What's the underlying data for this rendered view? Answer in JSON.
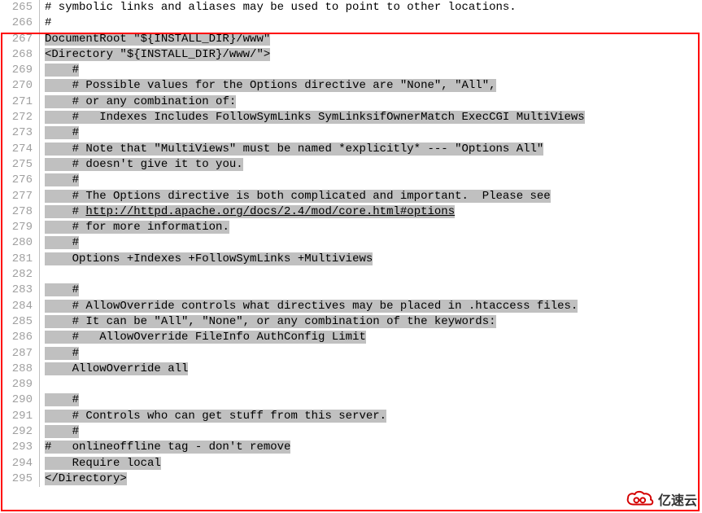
{
  "lines": [
    {
      "num": "265",
      "segs": [
        {
          "t": "# symbolic links and aliases may be used to point to other locations.",
          "hl": false
        }
      ]
    },
    {
      "num": "266",
      "segs": [
        {
          "t": "#",
          "hl": false
        }
      ]
    },
    {
      "num": "267",
      "segs": [
        {
          "t": "DocumentRoot \"${INSTALL_DIR}/www\"",
          "hl": true
        }
      ]
    },
    {
      "num": "268",
      "segs": [
        {
          "t": "<Directory \"${INSTALL_DIR}/www/\">",
          "hl": true
        }
      ]
    },
    {
      "num": "269",
      "segs": [
        {
          "t": "    ",
          "hl": true
        },
        {
          "t": "#",
          "hl": true
        }
      ]
    },
    {
      "num": "270",
      "segs": [
        {
          "t": "    ",
          "hl": true
        },
        {
          "t": "# Possible values for the Options directive are \"None\", \"All\",",
          "hl": true
        }
      ]
    },
    {
      "num": "271",
      "segs": [
        {
          "t": "    ",
          "hl": true
        },
        {
          "t": "# or any combination of:",
          "hl": true
        }
      ]
    },
    {
      "num": "272",
      "segs": [
        {
          "t": "    ",
          "hl": true
        },
        {
          "t": "#   Indexes Includes FollowSymLinks SymLinksifOwnerMatch ExecCGI MultiViews",
          "hl": true
        }
      ]
    },
    {
      "num": "273",
      "segs": [
        {
          "t": "    ",
          "hl": true
        },
        {
          "t": "#",
          "hl": true
        }
      ]
    },
    {
      "num": "274",
      "segs": [
        {
          "t": "    ",
          "hl": true
        },
        {
          "t": "# Note that \"MultiViews\" must be named *explicitly* --- \"Options All\"",
          "hl": true
        }
      ]
    },
    {
      "num": "275",
      "segs": [
        {
          "t": "    ",
          "hl": true
        },
        {
          "t": "# doesn't give it to you.",
          "hl": true
        }
      ]
    },
    {
      "num": "276",
      "segs": [
        {
          "t": "    ",
          "hl": true
        },
        {
          "t": "#",
          "hl": true
        }
      ]
    },
    {
      "num": "277",
      "segs": [
        {
          "t": "    ",
          "hl": true
        },
        {
          "t": "# The Options directive is both complicated and important.  Please see",
          "hl": true
        }
      ]
    },
    {
      "num": "278",
      "segs": [
        {
          "t": "    ",
          "hl": true
        },
        {
          "t": "# ",
          "hl": true
        },
        {
          "t": "http://httpd.apache.org/docs/2.4/mod/core.html#options",
          "hl": true,
          "u": true
        }
      ]
    },
    {
      "num": "279",
      "segs": [
        {
          "t": "    ",
          "hl": true
        },
        {
          "t": "# for more information.",
          "hl": true
        }
      ]
    },
    {
      "num": "280",
      "segs": [
        {
          "t": "    ",
          "hl": true
        },
        {
          "t": "#",
          "hl": true
        }
      ]
    },
    {
      "num": "281",
      "segs": [
        {
          "t": "    ",
          "hl": true
        },
        {
          "t": "Options +Indexes +FollowSymLinks +Multiviews",
          "hl": true
        }
      ]
    },
    {
      "num": "282",
      "segs": [
        {
          "t": "",
          "hl": false
        }
      ]
    },
    {
      "num": "283",
      "segs": [
        {
          "t": "    ",
          "hl": true
        },
        {
          "t": "#",
          "hl": true
        }
      ]
    },
    {
      "num": "284",
      "segs": [
        {
          "t": "    ",
          "hl": true
        },
        {
          "t": "# AllowOverride controls what directives may be placed in .htaccess files.",
          "hl": true
        }
      ]
    },
    {
      "num": "285",
      "segs": [
        {
          "t": "    ",
          "hl": true
        },
        {
          "t": "# It can be \"All\", \"None\", or any combination of the keywords:",
          "hl": true
        }
      ]
    },
    {
      "num": "286",
      "segs": [
        {
          "t": "    ",
          "hl": true
        },
        {
          "t": "#   AllowOverride FileInfo AuthConfig Limit",
          "hl": true
        }
      ]
    },
    {
      "num": "287",
      "segs": [
        {
          "t": "    ",
          "hl": true
        },
        {
          "t": "#",
          "hl": true
        }
      ]
    },
    {
      "num": "288",
      "segs": [
        {
          "t": "    ",
          "hl": true
        },
        {
          "t": "AllowOverride all",
          "hl": true
        }
      ]
    },
    {
      "num": "289",
      "segs": [
        {
          "t": "",
          "hl": false
        }
      ]
    },
    {
      "num": "290",
      "segs": [
        {
          "t": "    ",
          "hl": true
        },
        {
          "t": "#",
          "hl": true
        }
      ]
    },
    {
      "num": "291",
      "segs": [
        {
          "t": "    ",
          "hl": true
        },
        {
          "t": "# Controls who can get stuff from this server.",
          "hl": true
        }
      ]
    },
    {
      "num": "292",
      "segs": [
        {
          "t": "    ",
          "hl": true
        },
        {
          "t": "#",
          "hl": true
        }
      ]
    },
    {
      "num": "293",
      "segs": [
        {
          "t": "#   onlineoffline tag - don't remove",
          "hl": true
        }
      ]
    },
    {
      "num": "294",
      "segs": [
        {
          "t": "    ",
          "hl": true
        },
        {
          "t": "Require local",
          "hl": true
        }
      ]
    },
    {
      "num": "295",
      "segs": [
        {
          "t": "</Directory>",
          "hl": true
        }
      ]
    }
  ],
  "logo": {
    "text": "亿速云"
  }
}
